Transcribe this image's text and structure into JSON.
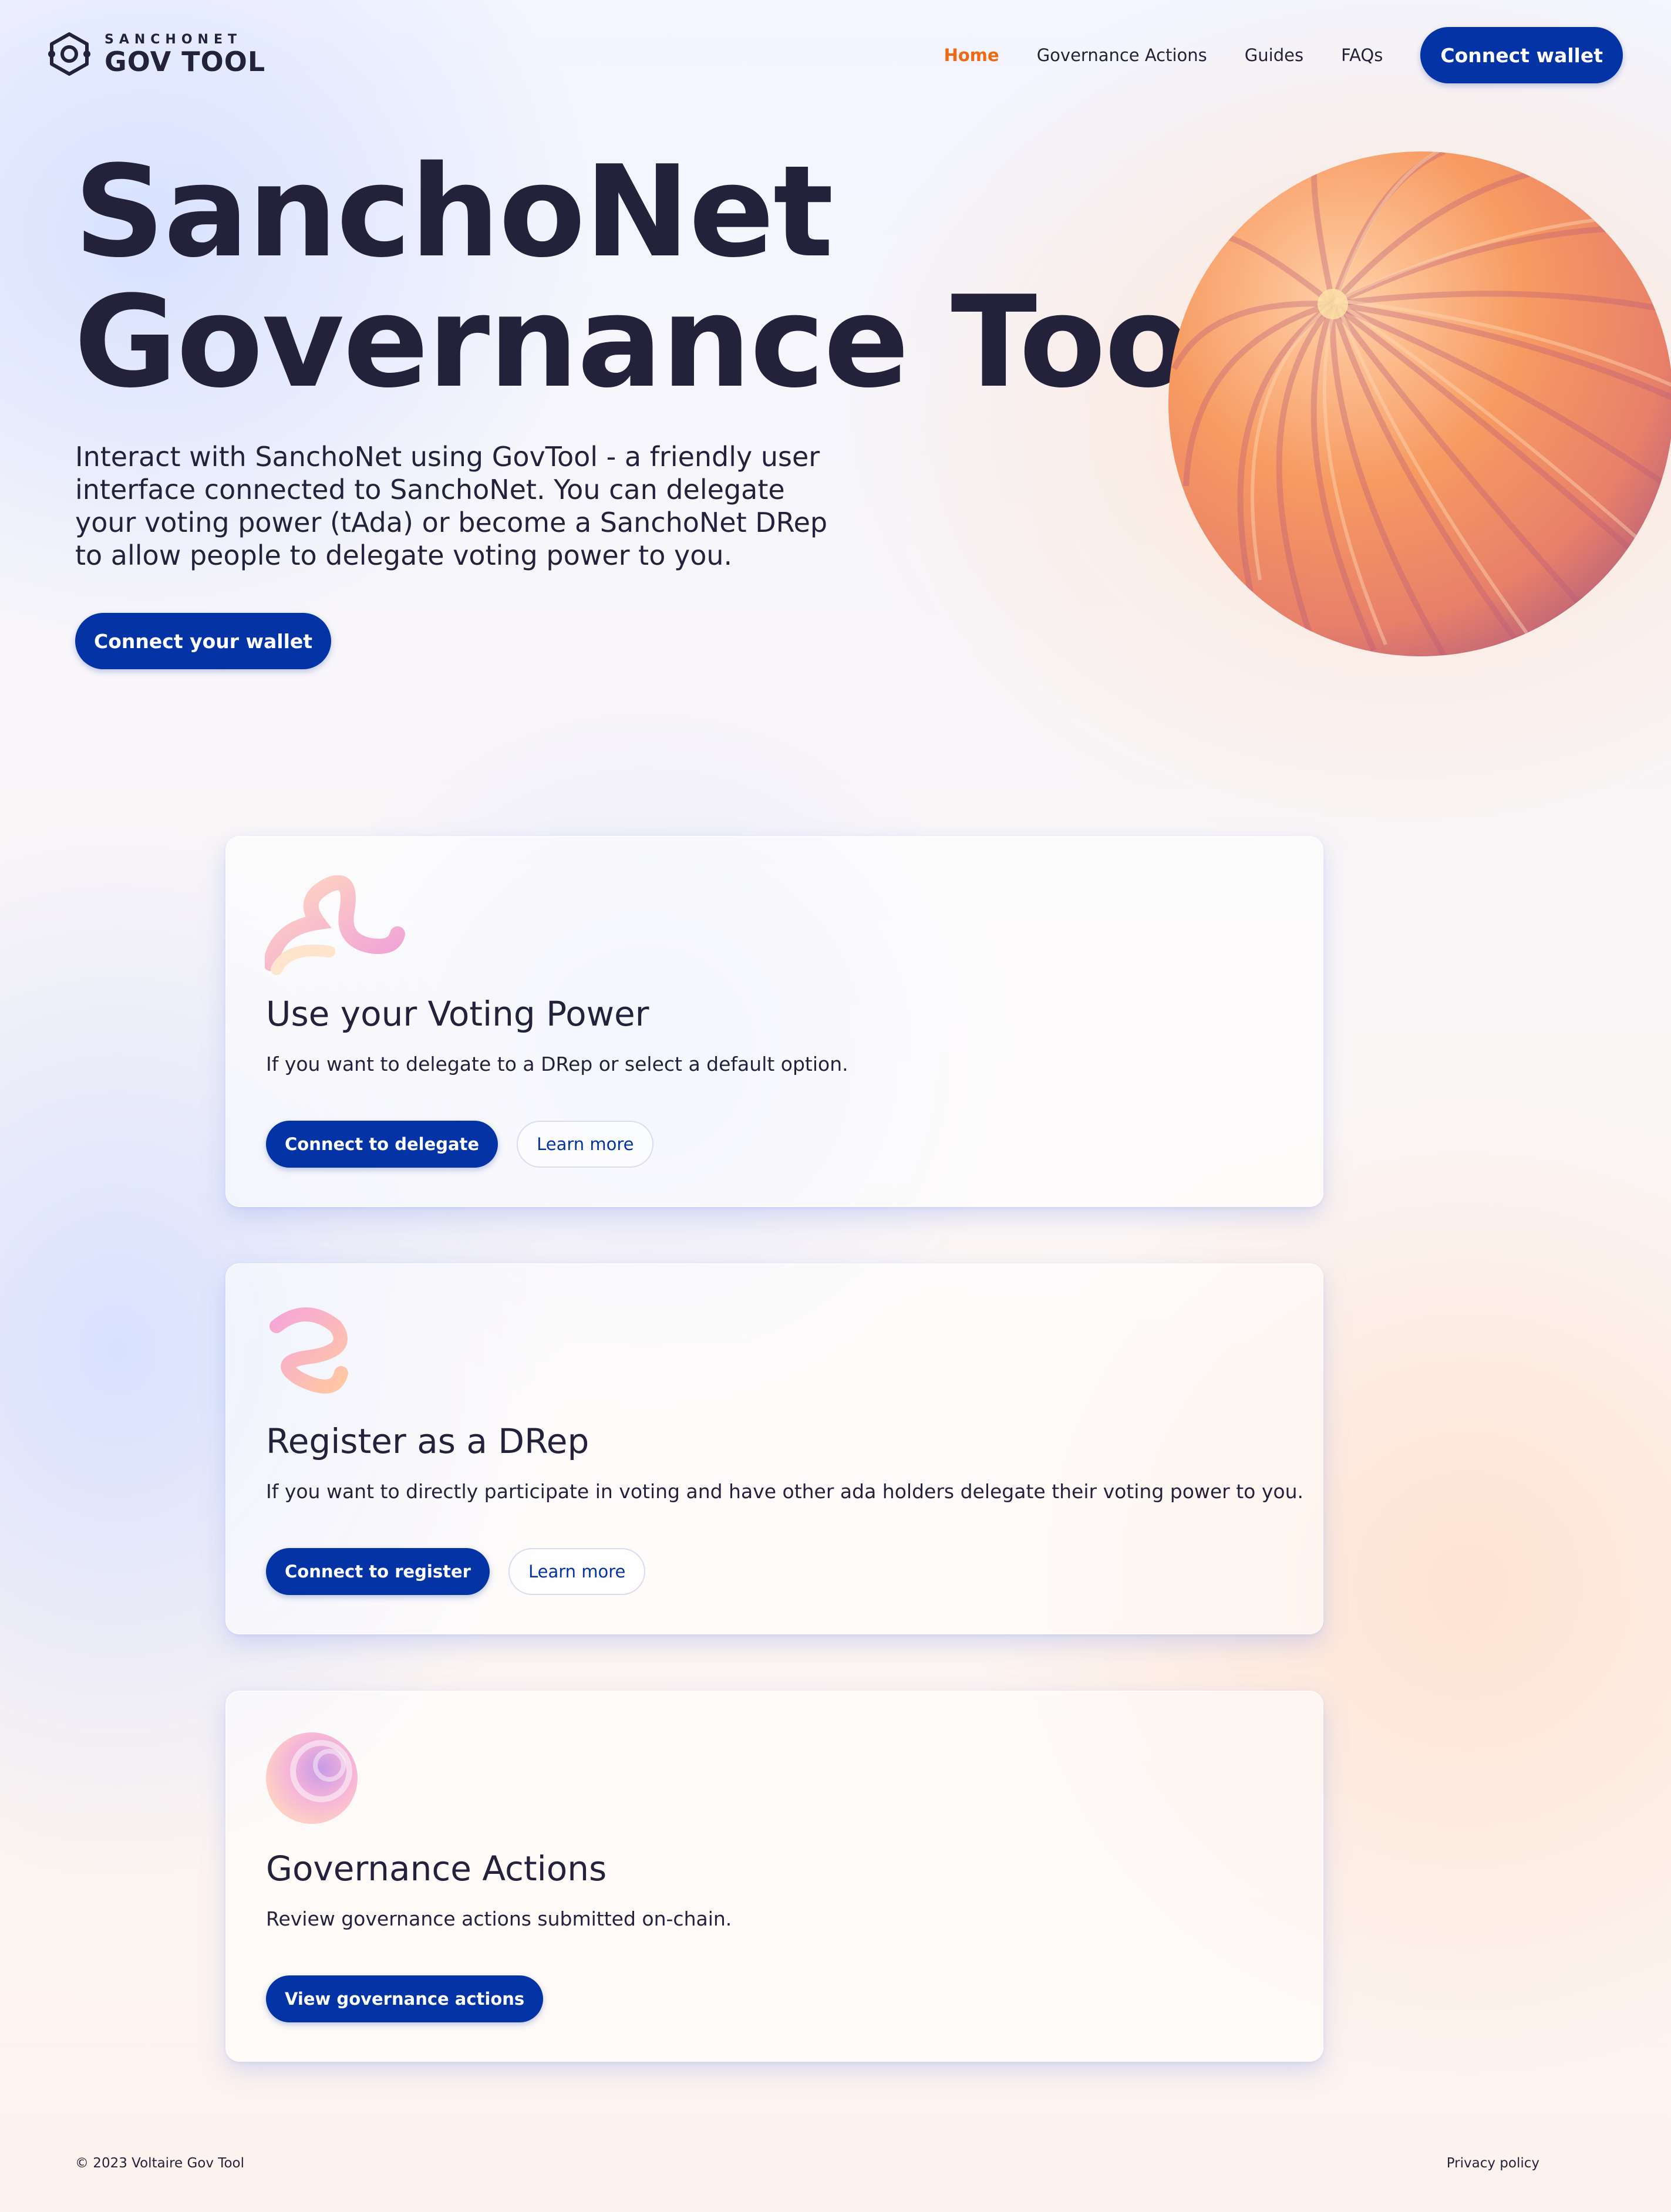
{
  "header": {
    "logo_small": "SANCHONET",
    "logo_big": "GOV TOOL",
    "nav": [
      {
        "label": "Home",
        "active": true
      },
      {
        "label": "Governance Actions",
        "active": false
      },
      {
        "label": "Guides",
        "active": false
      },
      {
        "label": "FAQs",
        "active": false
      }
    ],
    "connect_label": "Connect wallet"
  },
  "hero": {
    "title_line1": "SanchoNet",
    "title_line2": "Governance Tool",
    "description": "Interact with SanchoNet using GovTool - a friendly user interface connected to SanchoNet. You can delegate your voting power (tAda) or become a SanchoNet DRep to allow people to delegate voting power to you.",
    "cta_label": "Connect your wallet"
  },
  "cards": [
    {
      "title": "Use your Voting Power",
      "description": "If you want to delegate to a DRep or select a default option.",
      "primary_label": "Connect to delegate",
      "secondary_label": "Learn more"
    },
    {
      "title": "Register as a DRep",
      "description": "If you want to directly participate in voting and have other ada holders delegate their voting power to you.",
      "primary_label": "Connect to register",
      "secondary_label": "Learn more"
    },
    {
      "title": "Governance Actions",
      "description": "Review governance actions submitted on-chain.",
      "primary_label": "View governance actions"
    }
  ],
  "footer": {
    "copyright": "© 2023 Voltaire Gov Tool",
    "privacy": "Privacy policy"
  },
  "colors": {
    "primary": "#0433a6",
    "active_nav": "#ee6a12",
    "text": "#24223a",
    "accent_orange": "#f49a66"
  }
}
